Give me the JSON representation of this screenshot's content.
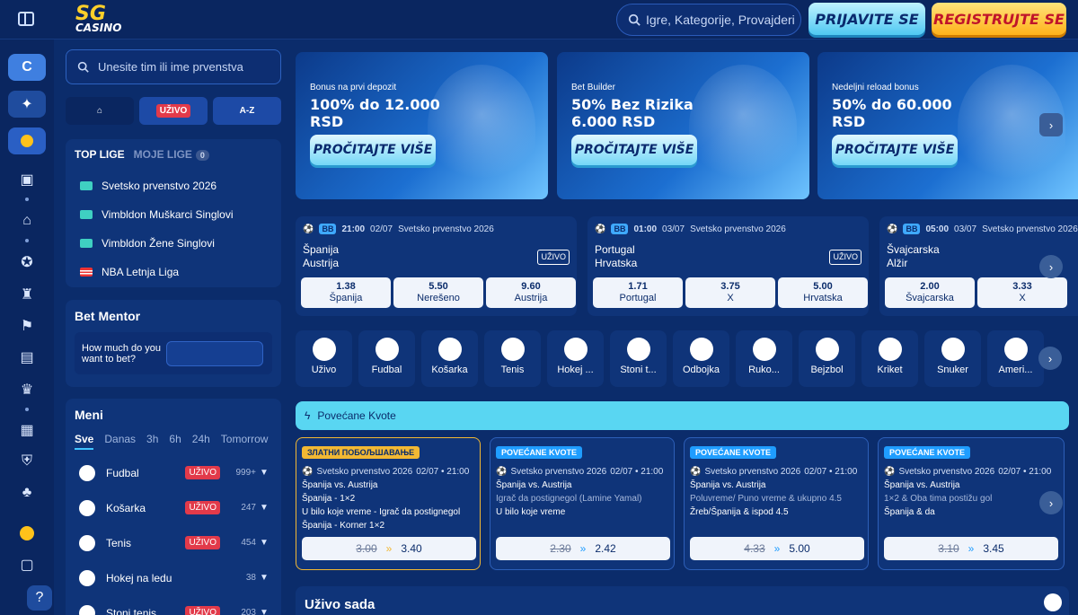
{
  "header": {
    "logo_main": "SG",
    "logo_sub": "CASINO",
    "search_placeholder": "Igre, Kategorije, Provajderi",
    "login_label": "PRIJAVITE SE",
    "register_label": "REGISTRUJTE SE"
  },
  "left": {
    "search_placeholder": "Unesite tim ili ime prvenstva",
    "tabs": [
      "",
      "UŽIVO",
      "A-Z"
    ],
    "top_lige_label": "TOP LIGE",
    "moje_lige_label": "MOJE LIGE",
    "moje_lige_count": "0",
    "leagues": [
      {
        "name": "Svetsko prvenstvo 2026"
      },
      {
        "name": "Vimbldon Muškarci Singlovi"
      },
      {
        "name": "Vimbldon Žene Singlovi"
      },
      {
        "name": "NBA Letnja Liga"
      }
    ],
    "bet_mentor": {
      "title": "Bet Mentor",
      "question": "How much do you want to bet?"
    },
    "meni": {
      "title": "Meni",
      "filters": [
        "Sve",
        "Danas",
        "3h",
        "6h",
        "24h",
        "Tomorrow"
      ],
      "sports": [
        {
          "name": "Fudbal",
          "live": "UŽIVO",
          "count": "999+"
        },
        {
          "name": "Košarka",
          "live": "UŽIVO",
          "count": "247"
        },
        {
          "name": "Tenis",
          "live": "UŽIVO",
          "count": "454"
        },
        {
          "name": "Hokej na ledu",
          "live": "",
          "count": "38"
        },
        {
          "name": "Stoni tenis",
          "live": "UŽIVO",
          "count": "203"
        }
      ]
    }
  },
  "banners": [
    {
      "tag": "Bonus na prvi depozit",
      "headline1": "100% do 12.000",
      "headline2": "RSD",
      "cta": "PROČITAJTE VIŠE"
    },
    {
      "tag": "Bet Builder",
      "headline1": "50% Bez Rizika",
      "headline2": "6.000 RSD",
      "cta": "PROČITAJTE VIŠE"
    },
    {
      "tag": "Nedeljni reload bonus",
      "headline1": "50% do 60.000",
      "headline2": "RSD",
      "cta": "PROČITAJTE VIŠE"
    }
  ],
  "matches": [
    {
      "time": "21:00",
      "date": "02/07",
      "league": "Svetsko prvenstvo 2026",
      "home": "Španija",
      "away": "Austrija",
      "live": "UŽIVO",
      "odds": [
        {
          "v": "1.38",
          "l": "Španija"
        },
        {
          "v": "5.50",
          "l": "Nerešeno"
        },
        {
          "v": "9.60",
          "l": "Austrija"
        }
      ]
    },
    {
      "time": "01:00",
      "date": "03/07",
      "league": "Svetsko prvenstvo 2026",
      "home": "Portugal",
      "away": "Hrvatska",
      "live": "UŽIVO",
      "odds": [
        {
          "v": "1.71",
          "l": "Portugal"
        },
        {
          "v": "3.75",
          "l": "X"
        },
        {
          "v": "5.00",
          "l": "Hrvatska"
        }
      ]
    },
    {
      "time": "05:00",
      "date": "03/07",
      "league": "Svetsko prvenstvo 2026",
      "home": "Švajcarska",
      "away": "Alžir",
      "live": "",
      "odds": [
        {
          "v": "2.00",
          "l": "Švajcarska"
        },
        {
          "v": "3.33",
          "l": "X"
        }
      ]
    }
  ],
  "sports_strip": [
    "Uživo",
    "Fudbal",
    "Košarka",
    "Tenis",
    "Hokej ...",
    "Stoni t...",
    "Odbojka",
    "Ruko...",
    "Bejzbol",
    "Kriket",
    "Snuker",
    "Ameri..."
  ],
  "povecane": {
    "title": "Povećane Kvote",
    "cards": [
      {
        "header": "ЗЛАТНИ ПОБОЉШАВАЊЕ",
        "gold": true,
        "league": "Svetsko prvenstvo 2026",
        "date": "02/07 • 21:00",
        "match": "Španija vs. Austrija",
        "l1": "Španija - 1×2",
        "l2": "U bilo koje vreme - Igrač da postignegol",
        "l3": "Španija - Korner 1×2",
        "old": "3.00",
        "new": "3.40"
      },
      {
        "header": "POVEĆANE KVOTE",
        "gold": false,
        "league": "Svetsko prvenstvo 2026",
        "date": "02/07 • 21:00",
        "match": "Španija vs. Austrija",
        "l1": "Igrač da postignegol (Lamine Yamal)",
        "l2": "U bilo koje vreme",
        "l3": "",
        "old": "2.30",
        "new": "2.42"
      },
      {
        "header": "POVEĆANE KVOTE",
        "gold": false,
        "league": "Svetsko prvenstvo 2026",
        "date": "02/07 • 21:00",
        "match": "Španija vs. Austrija",
        "l1": "Poluvreme/ Puno vreme & ukupno 4.5",
        "l2": "Žreb/Španija & ispod 4.5",
        "l3": "",
        "old": "4.33",
        "new": "5.00"
      },
      {
        "header": "POVEĆANE KVOTE",
        "gold": false,
        "league": "Svetsko prvenstvo 2026",
        "date": "02/07 • 21:00",
        "match": "Španija vs. Austrija",
        "l1": "1×2 & Oba tima postižu gol",
        "l2": "Španija & da",
        "l3": "",
        "old": "3.10",
        "new": "3.45"
      }
    ]
  },
  "uzivo_sada": "Uživo sada"
}
